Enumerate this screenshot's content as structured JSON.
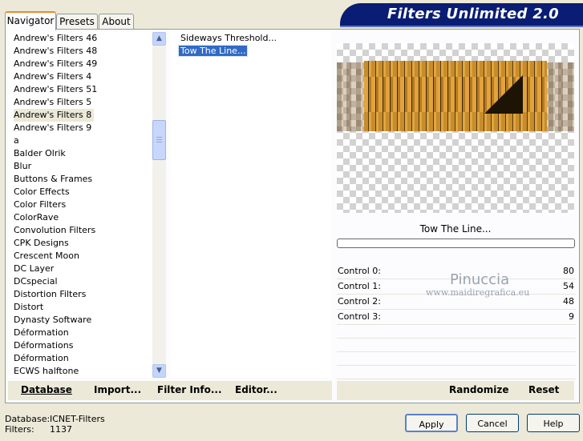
{
  "tabs": [
    "Navigator",
    "Presets",
    "About"
  ],
  "logo": "Filters Unlimited 2.0",
  "categories": [
    "Andrew's Filters 46",
    "Andrew's Filters 48",
    "Andrew's Filters 49",
    "Andrew's Filters 4",
    "Andrew's Filters 51",
    "Andrew's Filters 5",
    "Andrew's Filters 8",
    "Andrew's Filters 9",
    "a",
    "Balder Olrik",
    "Blur",
    "Buttons & Frames",
    "Color Effects",
    "Color Filters",
    "ColorRave",
    "Convolution Filters",
    "CPK Designs",
    "Crescent Moon",
    "DC Layer",
    "DCspecial",
    "Distortion Filters",
    "Distort",
    "Dynasty Software",
    "Déformation",
    "Déformations",
    "Déformation",
    "ECWS halftone"
  ],
  "selected_category_index": 6,
  "filters": [
    "Sideways Threshold...",
    "Tow The Line..."
  ],
  "selected_filter_index": 1,
  "filter_name": "Tow The Line...",
  "controls": [
    {
      "label": "Control 0:",
      "value": "80"
    },
    {
      "label": "Control 1:",
      "value": "54"
    },
    {
      "label": "Control 2:",
      "value": "48"
    },
    {
      "label": "Control 3:",
      "value": "9"
    }
  ],
  "watermark": {
    "name": "Pinuccia",
    "site": "www.maidiregrafica.eu"
  },
  "left_buttons": {
    "database": "Database",
    "import": "Import...",
    "filter_info": "Filter Info...",
    "editor": "Editor..."
  },
  "right_buttons": {
    "randomize": "Randomize",
    "reset": "Reset"
  },
  "info": {
    "database_label": "Database:",
    "database_value": "ICNET-Filters",
    "filters_label": "Filters:",
    "filters_value": "1137"
  },
  "dialog_buttons": {
    "apply": "Apply",
    "cancel": "Cancel",
    "help": "Help"
  },
  "colors": {
    "selection": "#316ac5",
    "banner": "#0a1d74",
    "tab_accent": "#e68b2c"
  }
}
